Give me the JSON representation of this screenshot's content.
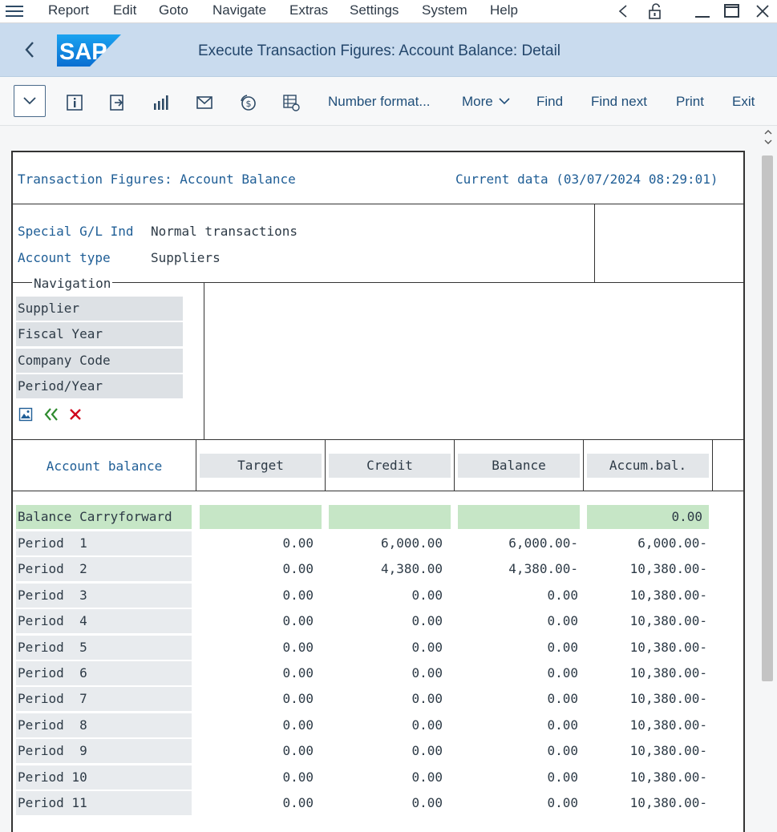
{
  "menu": {
    "items": [
      "Report",
      "Edit",
      "Goto",
      "Navigate",
      "Extras",
      "Settings",
      "System",
      "Help"
    ]
  },
  "titlebar": {
    "logo_text": "SAP",
    "title": "Execute Transaction Figures: Account Balance: Detail"
  },
  "toolbar": {
    "number_format": "Number format...",
    "more": "More",
    "find": "Find",
    "find_next": "Find next",
    "print": "Print",
    "exit": "Exit"
  },
  "report": {
    "heading": "Transaction Figures: Account Balance",
    "current_data": "Current data (03/07/2024 08:29:01)",
    "special_gl_label": "Special G/L Ind",
    "special_gl_value": "Normal transactions",
    "account_type_label": "Account type",
    "account_type_value": "Suppliers",
    "navigation_title": "Navigation",
    "navigation_items": [
      "Supplier",
      "Fiscal Year",
      "Company Code",
      "Period/Year"
    ],
    "columns": {
      "label": "Account balance",
      "target": "Target",
      "credit": "Credit",
      "balance": "Balance",
      "accum": "Accum.bal."
    },
    "carryforward": {
      "label": "Balance Carryforward",
      "accum": "0.00"
    },
    "rows": [
      {
        "label": "Period  1",
        "target": "0.00",
        "credit": "6,000.00",
        "balance": "6,000.00-",
        "accum": "6,000.00-"
      },
      {
        "label": "Period  2",
        "target": "0.00",
        "credit": "4,380.00",
        "balance": "4,380.00-",
        "accum": "10,380.00-"
      },
      {
        "label": "Period  3",
        "target": "0.00",
        "credit": "0.00",
        "balance": "0.00",
        "accum": "10,380.00-"
      },
      {
        "label": "Period  4",
        "target": "0.00",
        "credit": "0.00",
        "balance": "0.00",
        "accum": "10,380.00-"
      },
      {
        "label": "Period  5",
        "target": "0.00",
        "credit": "0.00",
        "balance": "0.00",
        "accum": "10,380.00-"
      },
      {
        "label": "Period  6",
        "target": "0.00",
        "credit": "0.00",
        "balance": "0.00",
        "accum": "10,380.00-"
      },
      {
        "label": "Period  7",
        "target": "0.00",
        "credit": "0.00",
        "balance": "0.00",
        "accum": "10,380.00-"
      },
      {
        "label": "Period  8",
        "target": "0.00",
        "credit": "0.00",
        "balance": "0.00",
        "accum": "10,380.00-"
      },
      {
        "label": "Period  9",
        "target": "0.00",
        "credit": "0.00",
        "balance": "0.00",
        "accum": "10,380.00-"
      },
      {
        "label": "Period 10",
        "target": "0.00",
        "credit": "0.00",
        "balance": "0.00",
        "accum": "10,380.00-"
      },
      {
        "label": "Period 11",
        "target": "0.00",
        "credit": "0.00",
        "balance": "0.00",
        "accum": "10,380.00-"
      }
    ]
  },
  "colors": {
    "titlebar_bg": "#c9dbee",
    "sap_blue": "#0a6ed1",
    "green_highlight": "#c6e6c6",
    "accent_text": "#1f5e96",
    "close_red": "#d0021b",
    "back_green": "#2e8b2e"
  },
  "icons": {
    "menu": "hamburger-icon",
    "back": "chevron-left-icon",
    "info": "info-icon",
    "export": "export-icon",
    "chart": "bar-chart-icon",
    "mail": "mail-icon",
    "currency": "currency-icon",
    "layout": "layout-settings-icon"
  }
}
